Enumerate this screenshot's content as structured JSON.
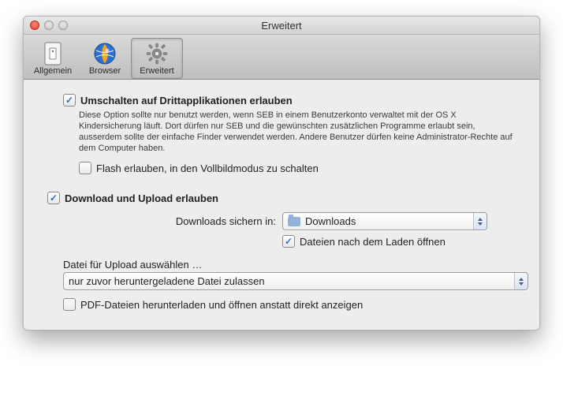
{
  "window_title": "Erweitert",
  "toolbar": {
    "items": [
      {
        "label": "Allgemein"
      },
      {
        "label": "Browser"
      },
      {
        "label": "Erweitert"
      }
    ]
  },
  "section1": {
    "switch_label": "Umschalten auf Drittapplikationen erlauben",
    "description": "Diese Option sollte nur benutzt werden, wenn SEB in einem Benutzerkonto verwaltet mit der OS X Kindersicherung läuft. Dort dürfen nur SEB und die gewünschten zusätzlichen Programme erlaubt sein, ausserdem sollte der einfache Finder verwendet werden. Andere Benutzer dürfen keine Administrator-Rechte auf dem Computer haben.",
    "flash_label": "Flash erlauben, in den Vollbildmodus zu schalten"
  },
  "section2": {
    "download_label": "Download und Upload erlauben",
    "downloads_save_label": "Downloads sichern in:",
    "downloads_folder": "Downloads",
    "open_after_label": "Dateien nach dem Laden öffnen",
    "upload_select_label": "Datei für Upload auswählen …",
    "upload_policy": "nur zuvor heruntergeladene Datei zulassen",
    "pdf_label": "PDF-Dateien herunterladen und öffnen anstatt direkt anzeigen"
  }
}
